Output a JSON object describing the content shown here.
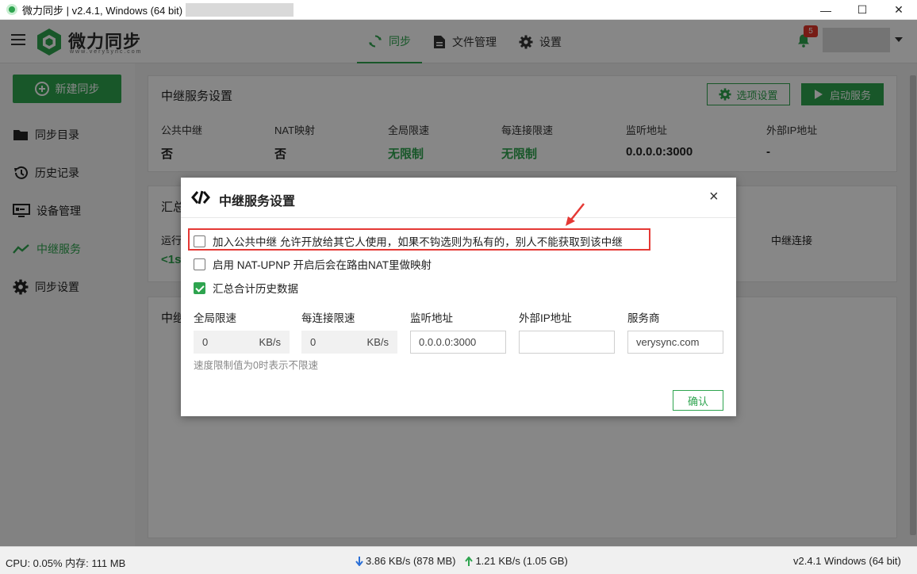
{
  "titlebar": {
    "title": "微力同步 | v2.4.1, Windows (64 bit)",
    "minimize": "—",
    "maximize": "☐",
    "close": "✕"
  },
  "header": {
    "brand": "微力同步",
    "brand_sub": "www.verysync.com",
    "nav": [
      {
        "label": "同步",
        "icon": "sync-icon",
        "active": true
      },
      {
        "label": "文件管理",
        "icon": "file-icon",
        "active": false
      },
      {
        "label": "设置",
        "icon": "gear-icon",
        "active": false
      }
    ],
    "notification_count": "5"
  },
  "sidebar": {
    "new_sync": "新建同步",
    "items": [
      {
        "label": "同步目录",
        "icon": "folder-icon"
      },
      {
        "label": "历史记录",
        "icon": "history-icon"
      },
      {
        "label": "设备管理",
        "icon": "device-icon"
      },
      {
        "label": "中继服务",
        "icon": "chart-line-icon",
        "active": true
      },
      {
        "label": "同步设置",
        "icon": "gear-icon"
      }
    ]
  },
  "relay_card": {
    "title": "中继服务设置",
    "options_btn": "选项设置",
    "start_btn": "启动服务",
    "stats": [
      {
        "label": "公共中继",
        "value": "否"
      },
      {
        "label": "NAT映射",
        "value": "否"
      },
      {
        "label": "全局限速",
        "value": "无限制"
      },
      {
        "label": "每连接限速",
        "value": "无限制"
      },
      {
        "label": "监听地址",
        "value": "0.0.0.0:3000"
      },
      {
        "label": "外部IP地址",
        "value": "-"
      }
    ]
  },
  "summary_card": {
    "title_frag": "汇总",
    "running_frag": "运行",
    "value_frag": "<1s",
    "relay_conn": "中继连接"
  },
  "third_card": {
    "title_frag": "中继"
  },
  "dialog": {
    "title": "中继服务设置",
    "close": "×",
    "checkboxes": [
      {
        "label": "加入公共中继 允许开放给其它人使用，如果不钩选则为私有的，别人不能获取到该中继",
        "checked": false
      },
      {
        "label": "启用 NAT-UPNP 开启后会在路由NAT里做映射",
        "checked": false
      },
      {
        "label": "汇总合计历史数据",
        "checked": true
      }
    ],
    "fields": [
      {
        "label": "全局限速",
        "value": "0",
        "unit": "KB/s"
      },
      {
        "label": "每连接限速",
        "value": "0",
        "unit": "KB/s"
      },
      {
        "label": "监听地址",
        "value": "0.0.0.0:3000",
        "unit": ""
      },
      {
        "label": "外部IP地址",
        "value": "",
        "unit": ""
      },
      {
        "label": "服务商",
        "value": "verysync.com",
        "unit": ""
      }
    ],
    "hint": "速度限制值为0时表示不限速",
    "ok": "确认"
  },
  "statusbar": {
    "cpu_mem": "CPU: 0.05%   内存: 111 MB",
    "down": "3.86 KB/s (878 MB)",
    "up": "1.21 KB/s (1.05 GB)",
    "version": "v2.4.1   Windows (64 bit)"
  },
  "colors": {
    "accent": "#2ea44f",
    "badge": "#e0352b",
    "highlight": "#e53935"
  }
}
